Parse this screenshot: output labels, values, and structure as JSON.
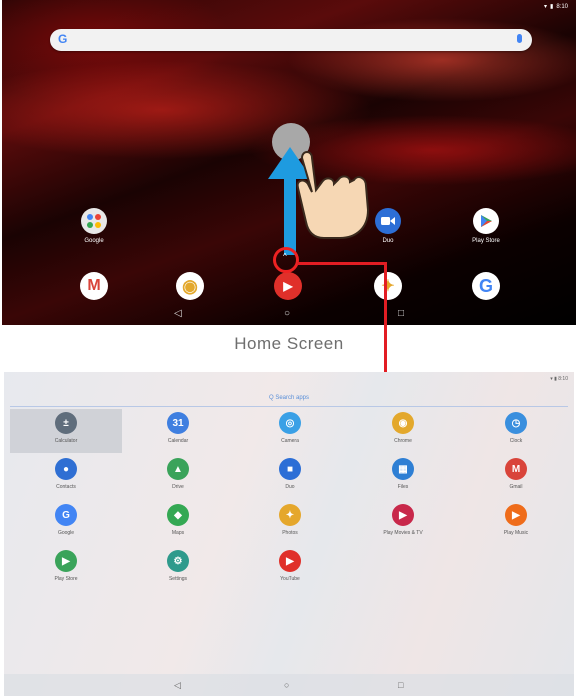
{
  "top": {
    "status": {
      "wifi": "▾",
      "battery": "▮",
      "time": "8:10"
    },
    "search": {
      "logo": "G"
    },
    "apps": [
      {
        "label": "Google",
        "icon": "google-folder-icon"
      },
      {
        "label": "Duo",
        "icon": "duo-icon"
      },
      {
        "label": "Play Store",
        "icon": "play-store-icon"
      }
    ],
    "dock": [
      {
        "icon": "gmail-icon",
        "glyph": "M"
      },
      {
        "icon": "chrome-icon",
        "glyph": "◉"
      },
      {
        "icon": "youtube-icon",
        "glyph": "▶"
      },
      {
        "icon": "photos-icon",
        "glyph": "✦"
      },
      {
        "icon": "google-icon",
        "glyph": "G"
      }
    ],
    "nav": {
      "back": "◁",
      "home": "○",
      "recents": "□"
    },
    "swipe_caret": "^"
  },
  "caption": "Home Screen",
  "drawer": {
    "status": "▾ ▮ 8:10",
    "search_placeholder": "Q Search apps",
    "apps": [
      {
        "label": "Calculator",
        "icon": "calculator-icon",
        "glyph": "±",
        "color": "#5f6d7c"
      },
      {
        "label": "Calendar",
        "icon": "calendar-icon",
        "glyph": "31",
        "color": "#3f7fe0"
      },
      {
        "label": "Camera",
        "icon": "camera-icon",
        "glyph": "◎",
        "color": "#3aa0e6"
      },
      {
        "label": "Chrome",
        "icon": "chrome-icon",
        "glyph": "◉",
        "color": "#e3a82c"
      },
      {
        "label": "Clock",
        "icon": "clock-icon",
        "glyph": "◷",
        "color": "#3a8fde"
      },
      {
        "label": "Contacts",
        "icon": "contacts-icon",
        "glyph": "●",
        "color": "#2f6fd3"
      },
      {
        "label": "Drive",
        "icon": "drive-icon",
        "glyph": "▲",
        "color": "#3aa35a"
      },
      {
        "label": "Duo",
        "icon": "duo-icon",
        "glyph": "■",
        "color": "#2c6ed6"
      },
      {
        "label": "Files",
        "icon": "files-icon",
        "glyph": "▦",
        "color": "#2e7fd4"
      },
      {
        "label": "Gmail",
        "icon": "gmail-icon",
        "glyph": "M",
        "color": "#d9443a"
      },
      {
        "label": "Google",
        "icon": "google-icon",
        "glyph": "G",
        "color": "#4285f4"
      },
      {
        "label": "Maps",
        "icon": "maps-icon",
        "glyph": "◆",
        "color": "#34a853"
      },
      {
        "label": "Photos",
        "icon": "photos-icon",
        "glyph": "✦",
        "color": "#e5a72c"
      },
      {
        "label": "Play Movies & TV",
        "icon": "play-movies-icon",
        "glyph": "▶",
        "color": "#c8284a"
      },
      {
        "label": "Play Music",
        "icon": "play-music-icon",
        "glyph": "▶",
        "color": "#ef6c1a"
      },
      {
        "label": "Play Store",
        "icon": "play-store-icon",
        "glyph": "▶",
        "color": "#3aa35a"
      },
      {
        "label": "Settings",
        "icon": "settings-icon",
        "glyph": "⚙",
        "color": "#2f9a8c"
      },
      {
        "label": "YouTube",
        "icon": "youtube-icon",
        "glyph": "▶",
        "color": "#e0302a"
      }
    ],
    "nav": {
      "back": "◁",
      "home": "○",
      "recents": "□"
    }
  },
  "colors": {
    "accent_red": "#e21d23",
    "arrow_blue": "#1e9be0"
  }
}
